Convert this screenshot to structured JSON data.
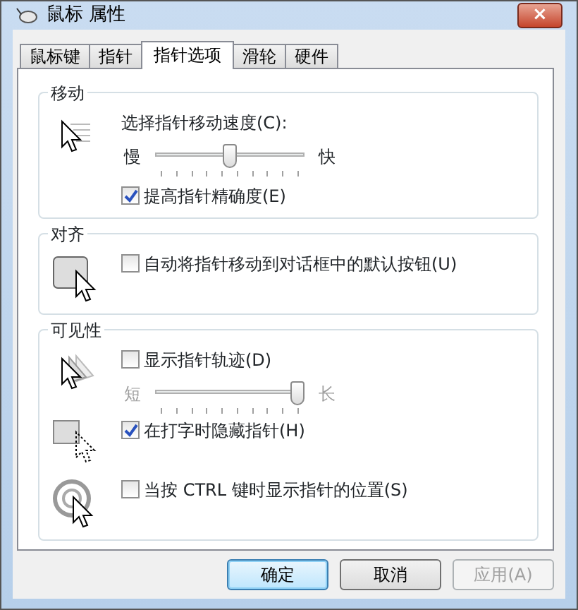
{
  "window": {
    "title": "鼠标 属性",
    "close": "×"
  },
  "tabs": [
    {
      "label": "鼠标键",
      "selected": false
    },
    {
      "label": "指针",
      "selected": false
    },
    {
      "label": "指针选项",
      "selected": true
    },
    {
      "label": "滑轮",
      "selected": false
    },
    {
      "label": "硬件",
      "selected": false
    }
  ],
  "groups": [
    {
      "title": "移动",
      "rows": [
        {
          "items": [
            {
              "kind": "label",
              "label": "选择指针移动速度(C):"
            },
            {
              "kind": "slider",
              "min_label": "慢",
              "max_label": "快",
              "level": 0.5,
              "disabled": false
            },
            {
              "kind": "checkbox",
              "label": "提高指针精确度(E)",
              "checked": true
            }
          ]
        }
      ]
    },
    {
      "title": "对齐",
      "rows": [
        {
          "items": [
            {
              "kind": "checkbox",
              "label": "自动将指针移动到对话框中的默认按钮(U)",
              "checked": false
            }
          ]
        }
      ]
    },
    {
      "title": "可见性",
      "rows": [
        {
          "items": [
            {
              "kind": "checkbox",
              "label": "显示指针轨迹(D)",
              "checked": false
            },
            {
              "kind": "slider",
              "min_label": "短",
              "max_label": "长",
              "level": 1,
              "disabled": true
            }
          ]
        },
        {
          "items": [
            {
              "kind": "checkbox",
              "label": "在打字时隐藏指针(H)",
              "checked": true
            }
          ]
        },
        {
          "items": [
            {
              "kind": "checkbox",
              "label": "当按 CTRL 键时显示指针的位置(S)",
              "checked": false
            }
          ]
        }
      ]
    }
  ],
  "buttons": [
    {
      "label": "确定",
      "default": true,
      "disabled": false
    },
    {
      "label": "取消",
      "default": false,
      "disabled": false
    },
    {
      "label": "应用(A)",
      "default": false,
      "disabled": true
    }
  ]
}
